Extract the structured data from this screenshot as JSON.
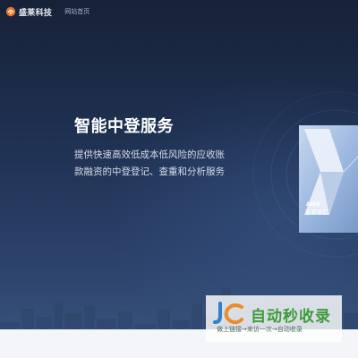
{
  "brand": {
    "name": "盛莱科技"
  },
  "nav": {
    "home_label": "网站首页"
  },
  "hero": {
    "title": "智能中登服务",
    "description": "提供快速高效低成本低风险的应收账款融资的中登登记、查重和分析服务"
  },
  "product_image": {
    "line1": "AMD",
    "line2": "EPYC"
  },
  "watermark": {
    "title": "自动秒收录",
    "subtitle": "做上链接→来访一次→自动收录"
  },
  "colors": {
    "background": "#1b2a46",
    "watermark_green": "#3f9a3a"
  }
}
